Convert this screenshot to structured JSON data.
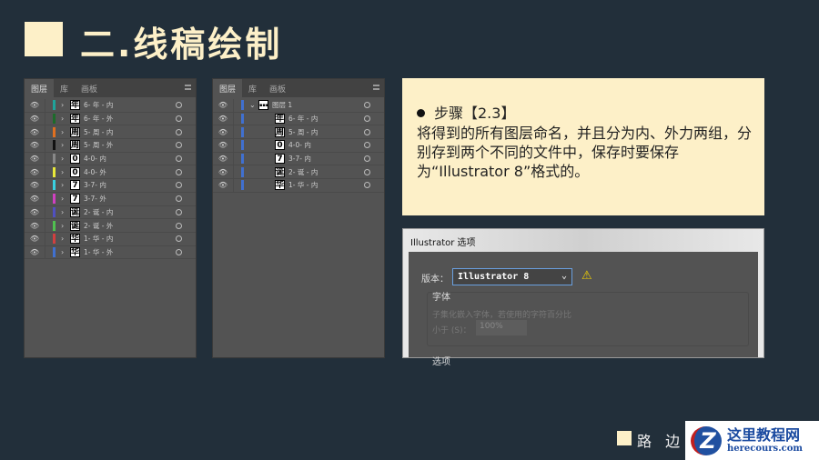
{
  "title": "二.线稿绘制",
  "panel_tabs": [
    "图层",
    "库",
    "画板"
  ],
  "left_layers": [
    {
      "name": "6- 年 - 内",
      "thumb": "年",
      "color": "#1fa39a"
    },
    {
      "name": "6- 年 - 外",
      "thumb": "年",
      "color": "#1c6b2a"
    },
    {
      "name": "5- 周 - 内",
      "thumb": "周",
      "color": "#e07020"
    },
    {
      "name": "5- 周 - 外",
      "thumb": "周",
      "color": "#111111"
    },
    {
      "name": "4-0- 内",
      "thumb": "0",
      "color": "#888888"
    },
    {
      "name": "4-0- 外",
      "thumb": "0",
      "color": "#e8e83a"
    },
    {
      "name": "3-7- 内",
      "thumb": "7",
      "color": "#3ad0e0"
    },
    {
      "name": "3-7- 外",
      "thumb": "7",
      "color": "#d040c0"
    },
    {
      "name": "2- 诞 - 内",
      "thumb": "诞",
      "color": "#5050c0"
    },
    {
      "name": "2- 诞 - 外",
      "thumb": "诞",
      "color": "#50c050"
    },
    {
      "name": "1- 华 - 内",
      "thumb": "华",
      "color": "#d04040"
    },
    {
      "name": "1- 华 - 外",
      "thumb": "华",
      "color": "#4070d0"
    }
  ],
  "right_group": {
    "name": "图层 1",
    "color": "#4070d0"
  },
  "right_layers": [
    {
      "name": "6- 年 - 内",
      "thumb": "年"
    },
    {
      "name": "5- 周 - 内",
      "thumb": "周"
    },
    {
      "name": "4-0- 内",
      "thumb": "0"
    },
    {
      "name": "3-7- 内",
      "thumb": "7"
    },
    {
      "name": "2- 诞 - 内",
      "thumb": "诞"
    },
    {
      "name": "1- 华 - 内",
      "thumb": "华"
    }
  ],
  "step": {
    "heading": "步骤【2.3】",
    "body": "将得到的所有图层命名，并且分为内、外力两组，分别存到两个不同的文件中，保存时要保存为“Illustrator 8”格式的。"
  },
  "dialog": {
    "title": "Illustrator 选项",
    "version_label": "版本：",
    "version_value": "Illustrator 8",
    "font_heading": "字体",
    "font_desc": "子集化嵌入字体，若使用的字符百分比",
    "less_than": "小于 (S)：",
    "percent": "100%",
    "options_heading": "选项"
  },
  "footer": "路 边 草",
  "watermark": {
    "title": "这里教程网",
    "url": "herecours.com"
  }
}
